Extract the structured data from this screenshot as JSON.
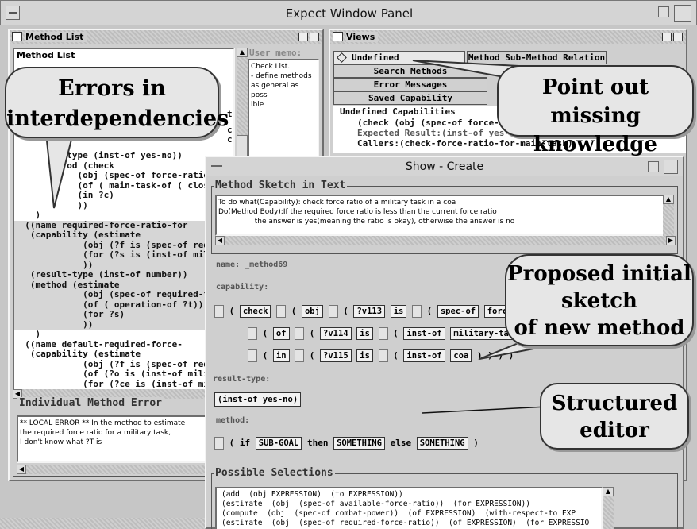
{
  "expect_window": {
    "title": "Expect Window Panel"
  },
  "method_list": {
    "panel_title": "Method List",
    "header": "Method List",
    "code_lines": [
      "         (type (inst-of yes-no))",
      "          od (check",
      "            (obj (spec-of force-ratio)",
      "            (of ( main-task-of ( close",
      "            (in ?c)",
      "            ))",
      "    )",
      "  ((name required-force-ratio-for",
      "   (capability (estimate",
      "             (obj (?f is (spec-of req",
      "             (for (?s is (inst-of mili",
      "             ))",
      "   (result-type (inst-of number))",
      "   (method (estimate",
      "             (obj (spec-of required-fo",
      "             (of ( operation-of ?t))",
      "             (for ?s)",
      "             ))",
      "    )",
      "  ((name default-required-force-",
      "   (capability (estimate",
      "             (obj (?f is (spec-of req",
      "             (of (?o is (inst-of milit",
      "             (for (?ce is (inst-of mili",
      "             ))"
    ]
  },
  "user_memo": {
    "label": "User memo:",
    "lines": [
      "Check List.",
      " - define methods",
      "as general as poss",
      "ible"
    ]
  },
  "partial_fragments": [
    "ta",
    "ci",
    "c)"
  ],
  "individual_error": {
    "title": "Individual Method Error",
    "lines": [
      "** LOCAL ERROR ** In the method to estimate",
      "the required force ratio for a military task,",
      "  I don't know what ?T is"
    ]
  },
  "views": {
    "panel_title": "Views",
    "tabs": [
      "Undefined Capabilities",
      "Method Sub-Method Relation",
      "Search Methods",
      "Error Messages",
      "Saved Capability"
    ],
    "header": "Undefined Capabilities",
    "lines": [
      "(check (obj (spec-of force-rati",
      "Expected Result:(inst-of yes-no)",
      "Callers:(check-force-ratio-for-main-task)"
    ]
  },
  "show_create": {
    "title": "Show - Create",
    "sketch_title": "Method Sketch in Text",
    "sketch_lines": [
      "To do what(Capability): check force ratio of a military task in a coa",
      "Do(Method Body):If the required force ratio is less than the current force ratio",
      "                the answer is yes(meaning the ratio is okay), otherwise the answer is no"
    ],
    "name": "name: _method69",
    "capability_label": "capability:",
    "line1": {
      "open": "(",
      "t1": "check",
      "p1": "(",
      "t2": "obj",
      "p2": "(",
      "t3": "?v113",
      "t4": "is",
      "p3": "(",
      "t5": "spec-of",
      "t6": "force-ratio"
    },
    "line2": {
      "p1": "(",
      "t1": "of",
      "p2": "(",
      "t2": "?v114",
      "t3": "is",
      "p3": "(",
      "t4": "inst-of",
      "t5": "military-task",
      "close": ")"
    },
    "line3": {
      "p1": "(",
      "t1": "in",
      "p2": "(",
      "t2": "?v115",
      "t3": "is",
      "p3": "(",
      "t4": "inst-of",
      "t5": "coa",
      "close": ") ) ) )"
    },
    "result_type_label": "result-type:",
    "result_type_value": "(inst-of yes-no)",
    "method_label": "method:",
    "method_line": {
      "open": "(",
      "if": "if",
      "t1": "SUB-GOAL",
      "then": "then",
      "t2": "SOMETHING",
      "else": "else",
      "t3": "SOMETHING",
      "close": ")"
    },
    "possible_title": "Possible Selections",
    "possible_lines": [
      "(add  (obj EXPRESSION)  (to EXPRESSION))",
      "(estimate  (obj  (spec-of available-force-ratio))  (for EXPRESSION))",
      "(compute  (obj  (spec-of combat-power))  (of EXPRESSION)  (with-respect-to EXP",
      "(estimate  (obj  (spec-of required-force-ratio))  (of EXPRESSION)  (for EXPRESSIO"
    ]
  },
  "callouts": {
    "errors": [
      "Errors in",
      "interdependencies"
    ],
    "missing": [
      "Point out missing",
      "knowledge"
    ],
    "proposed": [
      "Proposed initial",
      "sketch",
      "of new method"
    ],
    "structured": [
      "Structured",
      "editor"
    ]
  }
}
